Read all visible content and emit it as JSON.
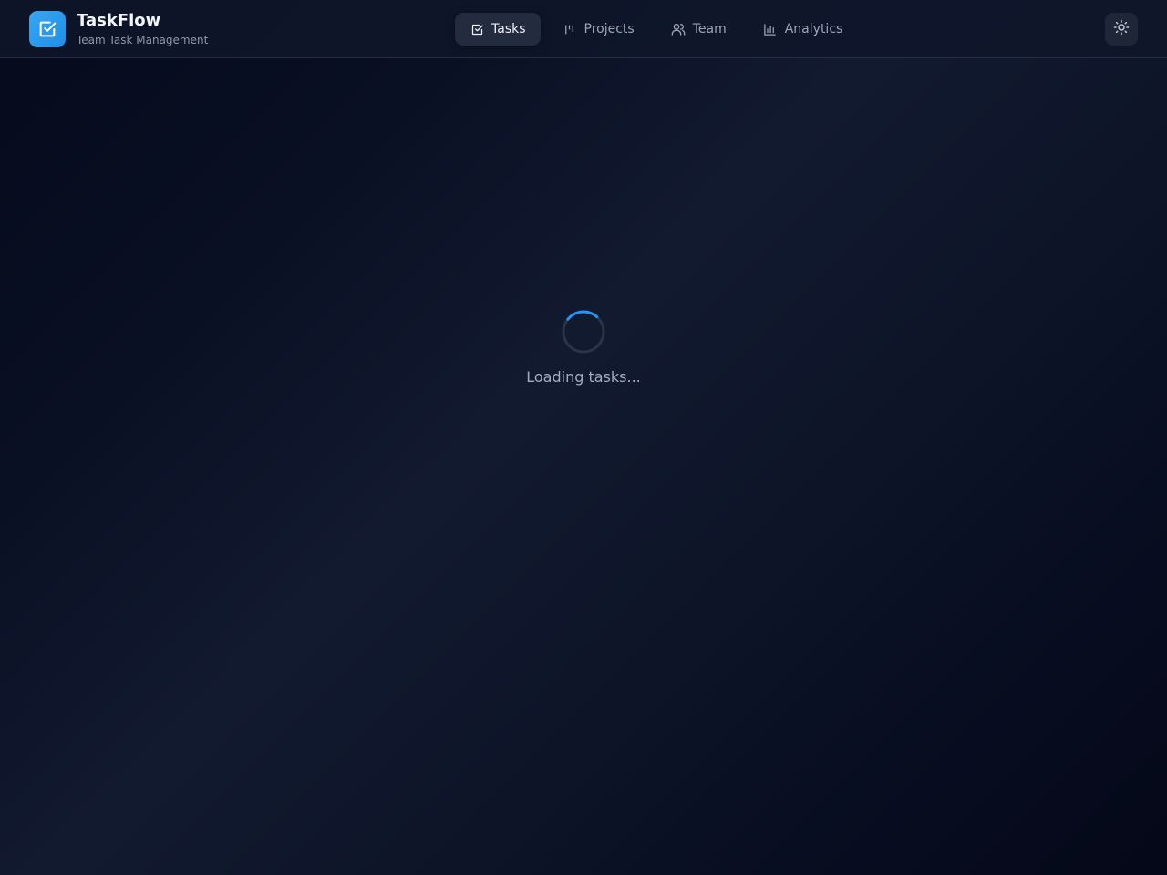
{
  "app": {
    "name": "TaskFlow",
    "subtitle": "Team Task Management"
  },
  "nav": {
    "items": [
      {
        "label": "Tasks",
        "icon": "checkbox-icon",
        "active": true
      },
      {
        "label": "Projects",
        "icon": "kanban-icon",
        "active": false
      },
      {
        "label": "Team",
        "icon": "users-icon",
        "active": false
      },
      {
        "label": "Analytics",
        "icon": "bar-chart-icon",
        "active": false
      }
    ]
  },
  "theme_toggle": {
    "icon": "sun-icon"
  },
  "loading": {
    "text": "Loading tasks..."
  },
  "colors": {
    "accent": "#2196f3",
    "logo_bg": "#1f8ee6",
    "header_bg": "#0f162a",
    "active_tab_bg": "#232b3e"
  }
}
